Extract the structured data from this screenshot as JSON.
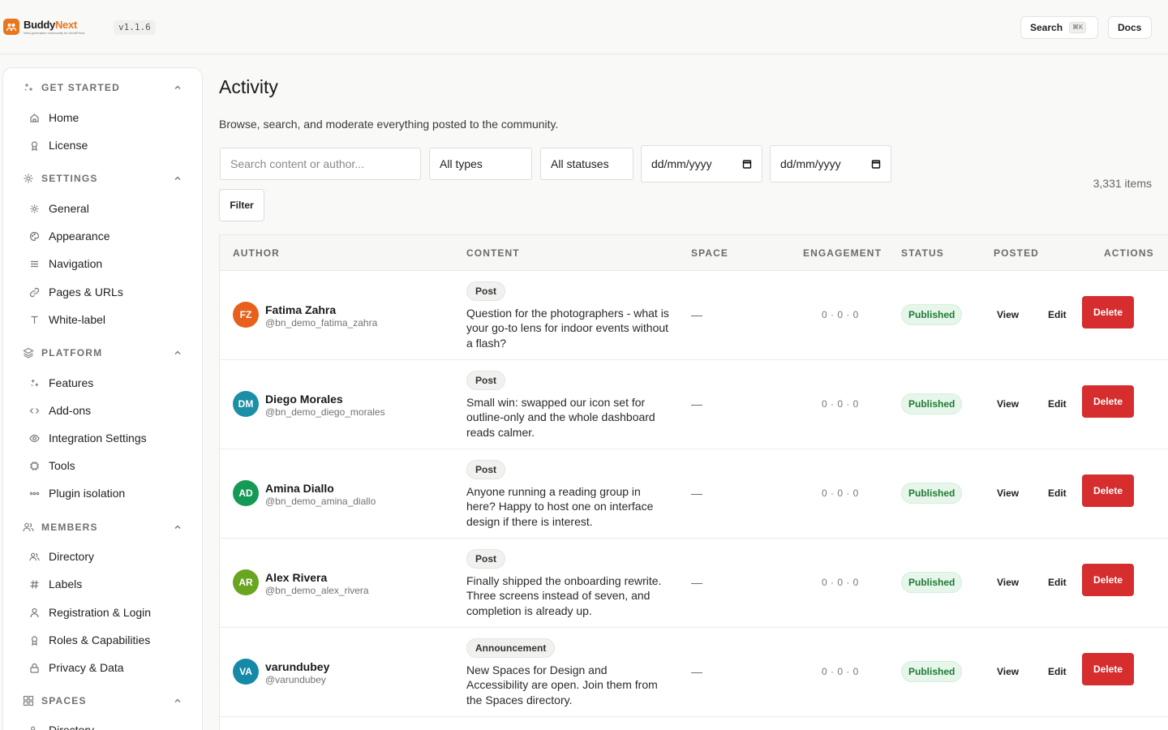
{
  "app": {
    "brand_first": "Buddy",
    "brand_second": "Next",
    "tagline": "Next-generation community for WordPress",
    "version": "v1.1.6",
    "search_label": "Search",
    "search_shortcut": "⌘K",
    "docs_label": "Docs"
  },
  "sidebar": {
    "sections": [
      {
        "title": "GET STARTED",
        "icon": "sparkles-icon",
        "items": [
          {
            "label": "Home",
            "icon": "home-icon"
          },
          {
            "label": "License",
            "icon": "badge-icon"
          }
        ]
      },
      {
        "title": "SETTINGS",
        "icon": "gear-icon",
        "items": [
          {
            "label": "General",
            "icon": "gear-icon"
          },
          {
            "label": "Appearance",
            "icon": "palette-icon"
          },
          {
            "label": "Navigation",
            "icon": "list-icon"
          },
          {
            "label": "Pages & URLs",
            "icon": "link-icon"
          },
          {
            "label": "White-label",
            "icon": "text-icon"
          }
        ]
      },
      {
        "title": "PLATFORM",
        "icon": "layers-icon",
        "items": [
          {
            "label": "Features",
            "icon": "sparkles-icon"
          },
          {
            "label": "Add-ons",
            "icon": "code-icon"
          },
          {
            "label": "Integration Settings",
            "icon": "eye-icon"
          },
          {
            "label": "Tools",
            "icon": "chip-icon"
          },
          {
            "label": "Plugin isolation",
            "icon": "dots-icon"
          }
        ]
      },
      {
        "title": "MEMBERS",
        "icon": "users-icon",
        "items": [
          {
            "label": "Directory",
            "icon": "users-icon"
          },
          {
            "label": "Labels",
            "icon": "hash-icon"
          },
          {
            "label": "Registration & Login",
            "icon": "user-icon"
          },
          {
            "label": "Roles & Capabilities",
            "icon": "badge-icon"
          },
          {
            "label": "Privacy & Data",
            "icon": "lock-icon"
          }
        ]
      },
      {
        "title": "SPACES",
        "icon": "grid-icon",
        "items": [
          {
            "label": "Directory",
            "icon": "users-icon"
          }
        ]
      }
    ]
  },
  "main": {
    "title": "Activity",
    "subtitle": "Browse, search, and moderate everything posted to the community.",
    "search_placeholder": "Search content or author...",
    "type_select": "All types",
    "status_select": "All statuses",
    "date_from": "dd/mm/yyyy",
    "date_to": "dd/mm/yyyy",
    "filter_label": "Filter",
    "item_count": "3,331 items"
  },
  "table": {
    "columns": [
      "AUTHOR",
      "CONTENT",
      "SPACE",
      "ENGAGEMENT",
      "STATUS",
      "POSTED",
      "ACTIONS"
    ],
    "action_labels": {
      "view": "View",
      "edit": "Edit",
      "delete": "Delete"
    },
    "rows": [
      {
        "initials": "FZ",
        "avatar_color": "#e8601c",
        "name": "Fatima Zahra",
        "handle": "@bn_demo_fatima_zahra",
        "type": "Post",
        "content": "Question for the photographers - what is your go-to lens for indoor events without a flash?",
        "space": "—",
        "engagement": "0 · 0 · 0",
        "status": "Published"
      },
      {
        "initials": "DM",
        "avatar_color": "#1b8fa6",
        "name": "Diego Morales",
        "handle": "@bn_demo_diego_morales",
        "type": "Post",
        "content": "Small win: swapped our icon set for outline-only and the whole dashboard reads calmer.",
        "space": "—",
        "engagement": "0 · 0 · 0",
        "status": "Published"
      },
      {
        "initials": "AD",
        "avatar_color": "#159a55",
        "name": "Amina Diallo",
        "handle": "@bn_demo_amina_diallo",
        "type": "Post",
        "content": "Anyone running a reading group in here? Happy to host one on interface design if there is interest.",
        "space": "—",
        "engagement": "0 · 0 · 0",
        "status": "Published"
      },
      {
        "initials": "AR",
        "avatar_color": "#6aa521",
        "name": "Alex Rivera",
        "handle": "@bn_demo_alex_rivera",
        "type": "Post",
        "content": "Finally shipped the onboarding rewrite. Three screens instead of seven, and completion is already up.",
        "space": "—",
        "engagement": "0 · 0 · 0",
        "status": "Published"
      },
      {
        "initials": "VA",
        "avatar_color": "#1789a8",
        "name": "varundubey",
        "handle": "@varundubey",
        "type": "Announcement",
        "content": "New Spaces for Design and Accessibility are open. Join them from the Spaces directory.",
        "space": "—",
        "engagement": "0 · 0 · 0",
        "status": "Published"
      }
    ]
  },
  "colors": {
    "accent": "#e8761e",
    "danger": "#d62e2e",
    "success_bg": "#e7f6ea",
    "success_text": "#1e7a34"
  }
}
